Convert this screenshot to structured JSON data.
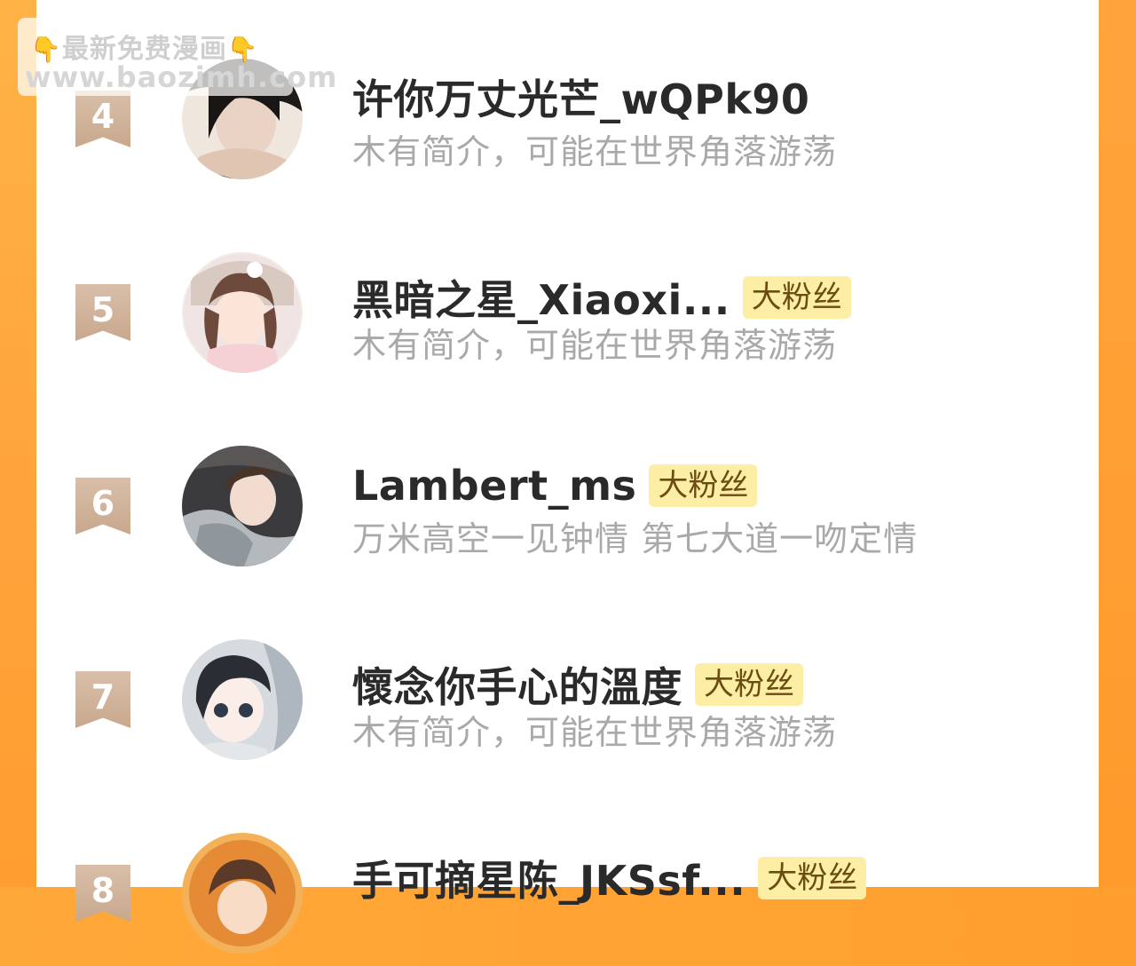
{
  "watermark": {
    "line1": "最新免费漫画",
    "line2": "www.baozimh.com",
    "hand_icon": "👇"
  },
  "rows": [
    {
      "rank": "4",
      "name": "许你万丈光芒_wQPk90",
      "badge": "",
      "bio": "木有简介，可能在世界角落游荡"
    },
    {
      "rank": "5",
      "name": "黑暗之星_Xiaoxi...",
      "badge": "大粉丝",
      "bio": "木有简介，可能在世界角落游荡"
    },
    {
      "rank": "6",
      "name": "Lambert_ms",
      "badge": "大粉丝",
      "bio": "万米高空一见钟情 第七大道一吻定情"
    },
    {
      "rank": "7",
      "name": "懷念你手心的溫度",
      "badge": "大粉丝",
      "bio": "木有简介，可能在世界角落游荡"
    },
    {
      "rank": "8",
      "name": "手可摘星陈_JKSsf...",
      "badge": "大粉丝",
      "bio": ""
    }
  ],
  "colors": {
    "accent_orange": "#ffa33a",
    "rank_badge": "#c8a88d",
    "fan_badge_bg": "#fdeea6",
    "fan_badge_text": "#6b4c12"
  }
}
